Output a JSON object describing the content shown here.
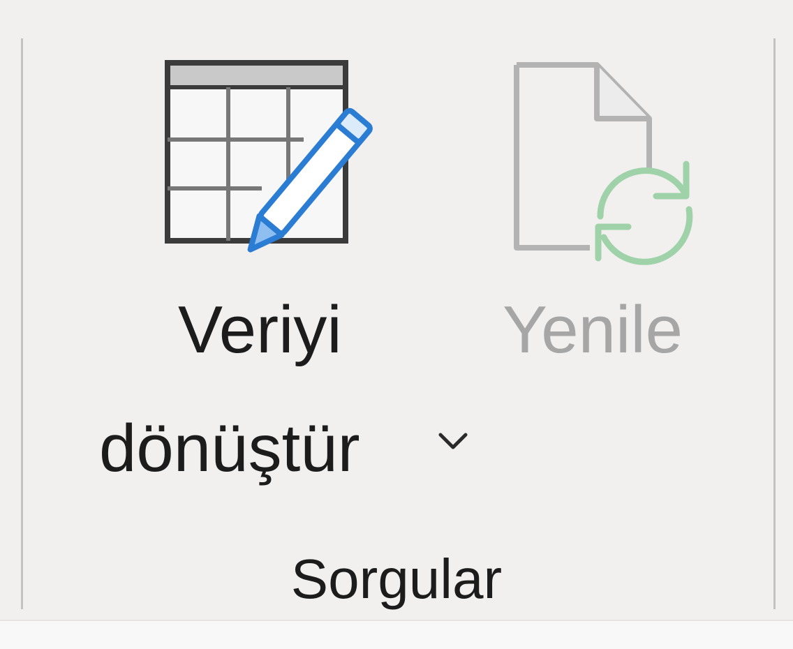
{
  "ribbon_group": {
    "name": "Sorgular",
    "buttons": {
      "transform_data": {
        "label_line1": "Veriyi",
        "label_line2": "dönüştür",
        "icon": "table-edit-icon",
        "has_dropdown": true,
        "enabled": true
      },
      "refresh": {
        "label": "Yenile",
        "icon": "refresh-document-icon",
        "enabled": false
      }
    }
  },
  "colors": {
    "background": "#f1f0ef",
    "text": "#1c1c1c",
    "disabled_text": "#a6a6a6",
    "pencil_blue": "#2b7cd3",
    "refresh_green": "#9fd2a9",
    "separator": "#c4c3c2"
  }
}
